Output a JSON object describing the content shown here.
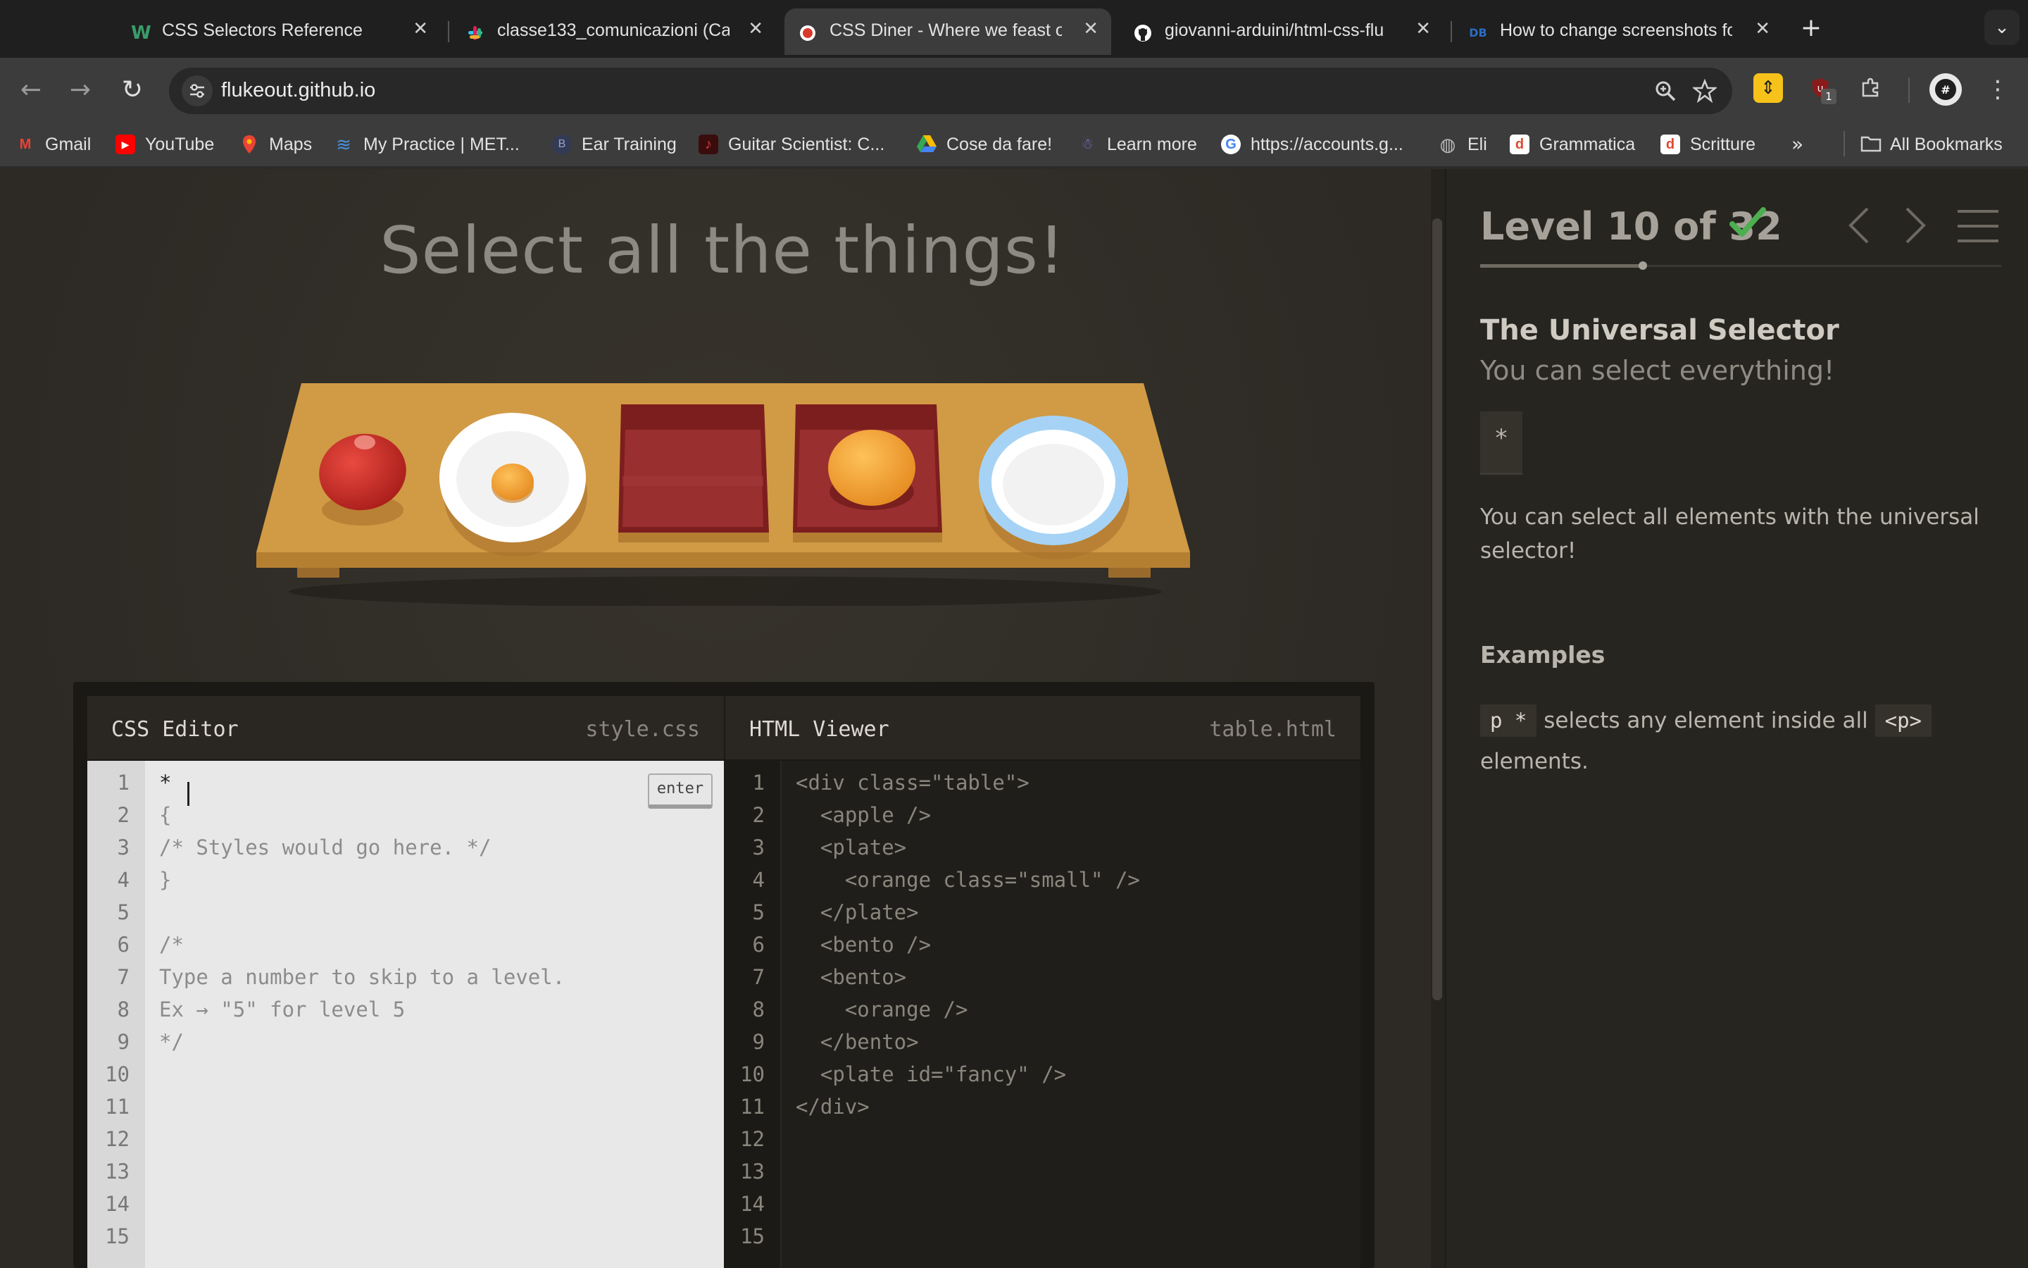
{
  "browser": {
    "tabs": [
      {
        "title": "CSS Selectors Reference",
        "favicon_color": "#3a9b6b",
        "favicon": "W",
        "active": false
      },
      {
        "title": "classe133_comunicazioni (Ca",
        "favicon_color": "#e01e5a",
        "favicon": "slack",
        "active": false
      },
      {
        "title": "CSS Diner - Where we feast o",
        "favicon_color": "#d9392b",
        "favicon": "●",
        "active": true
      },
      {
        "title": "giovanni-arduini/html-css-flu",
        "favicon_color": "#ffffff",
        "favicon": "github",
        "active": false
      },
      {
        "title": "How to change screenshots fo",
        "favicon_color": "#2b6cc4",
        "favicon": "DB",
        "active": false
      }
    ],
    "close_glyph": "✕",
    "new_tab_glyph": "+",
    "tab_menu_glyph": "⌄",
    "url": "flukeout.github.io",
    "back_glyph": "←",
    "forward_glyph": "→",
    "reload_glyph": "↻",
    "extension_badge": "1",
    "bookmarks": [
      {
        "label": "Gmail",
        "icon": "gmail-icon",
        "color": "#ea4335",
        "glyph": "M"
      },
      {
        "label": "YouTube",
        "icon": "youtube-icon",
        "color": "#ff0000",
        "glyph": "▶"
      },
      {
        "label": "Maps",
        "icon": "maps-icon",
        "color": "#34a853",
        "glyph": "⬤"
      },
      {
        "label": "My Practice | MET...",
        "icon": "met-icon",
        "color": "#4a90d9",
        "glyph": "≋"
      },
      {
        "label": "Ear Training",
        "icon": "ear-training-icon",
        "color": "#333a55",
        "glyph": "B"
      },
      {
        "label": "Guitar Scientist: C...",
        "icon": "guitar-icon",
        "color": "#8a1a1a",
        "glyph": "♪"
      },
      {
        "label": "Cose da fare!",
        "icon": "drive-icon",
        "color": "#fbbc04",
        "glyph": "▲"
      },
      {
        "label": "Learn more",
        "icon": "learn-icon",
        "color": "#7a7fe0",
        "glyph": "☃"
      },
      {
        "label": "https://accounts.g...",
        "icon": "google-icon",
        "color": "#4285f4",
        "glyph": "G"
      },
      {
        "label": "Eli",
        "icon": "globe-icon",
        "color": "#888888",
        "glyph": "◍"
      },
      {
        "label": "Grammatica",
        "icon": "grammatica-icon",
        "color": "#e0492f",
        "glyph": "d"
      },
      {
        "label": "Scritture",
        "icon": "scritture-icon",
        "color": "#e0492f",
        "glyph": "d"
      }
    ],
    "bookmarks_more": "»",
    "all_bookmarks": "All Bookmarks"
  },
  "game": {
    "instruction": "Select all the things!",
    "level_label": "Level 10 of 32",
    "level": 10,
    "total_levels": 32,
    "completed": true,
    "accent_check": "#4caf50",
    "table_color": "#d19a45",
    "css_editor": {
      "title": "CSS Editor",
      "file": "style.css",
      "enter_label": "enter",
      "lines": [
        "*",
        "{",
        "/* Styles would go here. */",
        "}",
        "",
        "/*",
        "Type a number to skip to a level.",
        "Ex → \"5\" for level 5",
        "*/",
        "",
        "",
        "",
        "",
        "",
        ""
      ]
    },
    "html_viewer": {
      "title": "HTML Viewer",
      "file": "table.html",
      "lines": [
        "<div class=\"table\">",
        "  <apple />",
        "  <plate>",
        "    <orange class=\"small\" />",
        "  </plate>",
        "  <bento />",
        "  <bento>",
        "    <orange />",
        "  </bento>",
        "  <plate id=\"fancy\" />",
        "</div>",
        "",
        "",
        "",
        ""
      ]
    },
    "sidebar": {
      "selector_name": "The Universal Selector",
      "selector_title": "You can select everything!",
      "syntax": "*",
      "description": "You can select all elements with the universal selector!",
      "examples_heading": "Examples",
      "example_code": "p *",
      "example_text": "selects any element inside all",
      "example_code_2": "<p>",
      "example_text_2": "elements."
    }
  }
}
